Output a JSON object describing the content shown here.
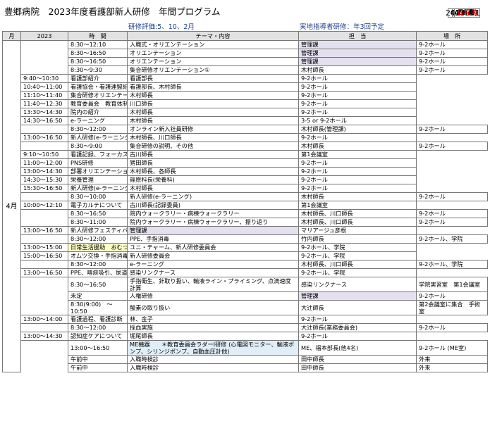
{
  "header": {
    "title": "豊郷病院　2023年度看護部新人研修　年間プログラム",
    "date": "2023.4.1",
    "eval_note": "研修評価:5、10、2月",
    "instructor_note": "実地指導者研修：年3回予定"
  },
  "columns": [
    "月",
    "2023",
    "時　間",
    "テーマ・内容",
    "担　当",
    "場　所"
  ],
  "month_label": "4月",
  "groups": [
    {
      "date": "4/1(土)",
      "rows": [
        {
          "time": "8:30～12:10",
          "theme": "入職式・オリエンテーション",
          "staff": "管理課",
          "place": "9-2ホール"
        }
      ]
    },
    {
      "date": "4/3(月)",
      "rows": [
        {
          "time": "8:30～16:50",
          "theme": "オリエンテーション",
          "staff": "管理課",
          "place": "9-2ホール"
        }
      ]
    },
    {
      "date": "4/4(火)",
      "rows": [
        {
          "time": "8:30～16:50",
          "theme": "オリエンテーション",
          "staff": "管理課",
          "place": "9-2ホール"
        }
      ]
    },
    {
      "date": "4/5(水)",
      "rows": [
        {
          "time": "8:30～9:30",
          "theme": "集合研修オリエンテーション①",
          "staff": "木村師長",
          "place": "9-2ホール"
        },
        {
          "time": "9:40～10:30",
          "theme": "看護部紹介",
          "staff": "看護部長",
          "place": "9-2ホール"
        },
        {
          "time": "10:40～11:00",
          "theme": "看護協会・看護連盟紹介",
          "staff": "看護部長、木村師長",
          "place": "9-2ホール"
        },
        {
          "time": "11:10～11:40",
          "theme": "集合研修オリエンテーション②",
          "staff": "木村師長",
          "place": "9-2ホール"
        },
        {
          "time": "11:40～12:30",
          "theme": "教育委員会　教育体制説明",
          "staff": "川口師長",
          "place": "9-2ホール"
        },
        {
          "time": "13:30～14:30",
          "theme": "院内の紹介",
          "staff": "木村師長",
          "place": "9-2ホール"
        },
        {
          "time": "14:30～16:50",
          "theme": "e-ラーニング",
          "staff": "木村師長",
          "place": "3-5 or 9-2ホール"
        }
      ]
    },
    {
      "date": "4/6(木)",
      "rows": [
        {
          "time": "8:30～12:00",
          "theme": "オンライン新入社員研修",
          "staff": "木村師長(管理課)",
          "place": "9-2ホール"
        },
        {
          "time": "13:00～16:50",
          "theme": "新人研修(e-ラーニング)",
          "staff": "木村師長、川口師長",
          "place": "9-2ホール"
        }
      ]
    },
    {
      "date": "4/7(金)",
      "rows": [
        {
          "time": "8:30～9:00",
          "theme": "集合研修の説明、その他",
          "staff": "木村師長",
          "place": "9-2ホール"
        },
        {
          "time": "9:10～10:50",
          "theme": "看護記録、フォーカスチャーティング、看護必要度",
          "staff": "古川師長",
          "place": "第1会議室"
        },
        {
          "time": "11:00～12:00",
          "theme": "PNS研修",
          "staff": "猪田師長",
          "place": "9-2ホール"
        },
        {
          "time": "13:00～14:30",
          "theme": "部署オリエンテーション",
          "staff": "木村師長、各師長",
          "place": "9-2ホール"
        },
        {
          "time": "14:30～15:30",
          "theme": "栄養管理",
          "staff": "篠原科長(栄養科)",
          "place": "9-2ホール"
        },
        {
          "time": "15:30～16:50",
          "theme": "新人研修(e-ラーニング)",
          "staff": "木村師長",
          "place": "9-2ホール"
        }
      ]
    },
    {
      "date": "4/8(土)",
      "rows": [
        {
          "time": "8:30～10:00",
          "theme": "新人研修(e-ラーニング)",
          "staff": "木村師長",
          "place": "9-2ホール"
        },
        {
          "time": "10:00～12:10",
          "theme": "電子カルテについて",
          "staff": "古川師長(記録委員)",
          "place": "第1会議室"
        }
      ]
    },
    {
      "date": "4/10(月)",
      "rows": [
        {
          "time": "8:30～16:50",
          "theme": "院内ウォークラリー・病棟ウォークラリー",
          "staff": "木村師長、川口師長",
          "place": "9-2ホール"
        }
      ]
    },
    {
      "date": "4/11(火)",
      "rows": [
        {
          "time": "8:30～11:00",
          "theme": "院内ウォークラリー・病棟ウォークラリー、振り返り",
          "staff": "木村師長、川口師長",
          "place": "9-2ホール"
        },
        {
          "time": "13:00～16:50",
          "theme": "新人研修フェスティバル",
          "staff": "管理課",
          "place": "マリアージュ彦根"
        }
      ]
    },
    {
      "date": "4/12(水)",
      "rows": [
        {
          "time": "8:30～12:00",
          "theme": "PPE、手指消毒",
          "staff": "竹内師長",
          "place": "9-2ホール、学院"
        },
        {
          "time": "13:00～15:00",
          "theme": "日常生活援助　おむつ交換(CWも含む)",
          "staff": "ユニ・チャーム、新人研修委員会",
          "place": "9-2ホール、学院"
        },
        {
          "time": "15:00～16:50",
          "theme": "オムツ交換・手指消毒・PPEの実践",
          "staff": "新人研修委員会",
          "place": "9-2ホール、学院"
        }
      ]
    },
    {
      "date": "4/13(木)",
      "rows": [
        {
          "time": "8:30～12:00",
          "theme": "e-ラーニング",
          "staff": "木村師長、川口師長",
          "place": "9-2ホール、学院"
        },
        {
          "time": "13:00～16:50",
          "theme": "PPE、喀痰吸引、尿道カテーテル",
          "staff": "感染リンクナース",
          "place": "9-2ホール、学院"
        }
      ]
    },
    {
      "date": "4/14(金)",
      "rows": [
        {
          "time": "8:30～16:50",
          "theme": "手指衛生、針取り扱い、輸液ライン・プライミング、点滴速度計算",
          "staff": "感染リンクナース",
          "place": "学院実習室　第1会議室"
        }
      ]
    },
    {
      "date": "日程未",
      "rows": [
        {
          "time": "未定",
          "theme": "人権研修",
          "staff": "管理課",
          "place": "9-2ホール"
        }
      ]
    },
    {
      "date": "4/18(火)",
      "rows": [
        {
          "time": "8:30(9:00)　～10:50",
          "theme": "酸素の取り扱い",
          "staff": "大辻師長",
          "place": "第2会議室に集合　手術室"
        },
        {
          "time": "13:00～14:00",
          "theme": "看護過程、看護診断",
          "staff": "林、金子",
          "place": "9-2ホール"
        }
      ]
    },
    {
      "date": "4/21(金)",
      "rows": [
        {
          "time": "8:30～12:00",
          "theme": "採血実施",
          "staff": "大辻師長(業務委員会)",
          "place": "9-2ホール"
        },
        {
          "time": "13:00～14:30",
          "theme": "認知症ケアについて",
          "staff": "堀尾師長",
          "place": "9-2ホール"
        }
      ]
    },
    {
      "date": "4/25(火)",
      "rows": [
        {
          "time": "13:00～16:50",
          "theme": "ME機器　　＊教育委員会ラダーⅠ研修 (心電図モニター、輸液ポンプ、シリンジポンプ、自動血圧計他)",
          "staff": "ME、福本部長(他4名)",
          "place": "9-2ホール (ME室)"
        }
      ]
    },
    {
      "date": "日程未",
      "rows": [
        {
          "time": "午前中",
          "theme": "入職時検診",
          "staff": "田中師長",
          "place": "外来"
        }
      ]
    },
    {
      "date": "日程未",
      "rows": [
        {
          "time": "午前中",
          "theme": "入職時検診",
          "staff": "田中師長",
          "place": "外来"
        }
      ]
    }
  ]
}
